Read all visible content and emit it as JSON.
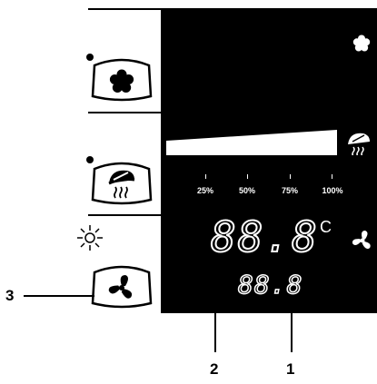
{
  "sections": {
    "fan_speed": {
      "icon": "flower-icon",
      "indicator_icon": "flower-icon"
    },
    "intensity": {
      "icon": "heat-spray-icon",
      "indicator_icon": "heat-spray-icon",
      "scale_labels": [
        "25%",
        "50%",
        "75%",
        "100%"
      ]
    },
    "fan": {
      "icon": "fan-icon",
      "indicator_icon": "fan-icon",
      "main_display": "88.8",
      "main_unit": "C",
      "sub_display": "88.8"
    }
  },
  "callouts": {
    "one": "1",
    "two": "2",
    "three": "3"
  }
}
